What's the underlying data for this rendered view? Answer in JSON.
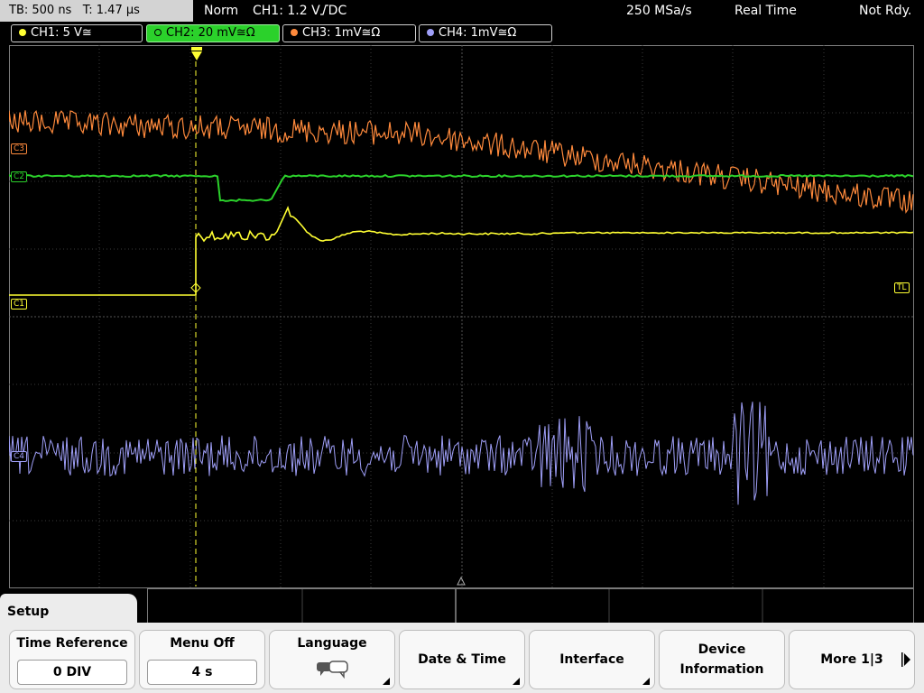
{
  "status": {
    "timebase": "TB: 500 ns",
    "trigger_time": "T: 1.47 µs",
    "mode": "Norm",
    "trigger_source": "CH1: 1.2 V",
    "trigger_coupling": "DC",
    "sample_rate": "250 MSa/s",
    "acq_mode": "Real Time",
    "state": "Not Rdy."
  },
  "channels": [
    {
      "label": "CH1: 5 V≅",
      "color": "#ffff33"
    },
    {
      "label": "CH2: 20 mV≅Ω",
      "color": "#2bd12b"
    },
    {
      "label": "CH3: 1mV≅Ω",
      "color": "#ff8a3c"
    },
    {
      "label": "CH4: 1mV≅Ω",
      "color": "#9f9ff8"
    }
  ],
  "markers": {
    "c1": "C1",
    "c2": "C2",
    "c3": "C3",
    "c4": "C4",
    "tl": "TL"
  },
  "menu": {
    "title": "Setup",
    "softkeys": [
      {
        "label": "Time Reference",
        "value": "0 DIV"
      },
      {
        "label": "Menu Off",
        "value": "4 s"
      },
      {
        "label": "Language"
      },
      {
        "label": "Date & Time"
      },
      {
        "label": "Interface"
      },
      {
        "label": "Device",
        "label2": "Information"
      },
      {
        "label": "More 1|3"
      }
    ]
  }
}
